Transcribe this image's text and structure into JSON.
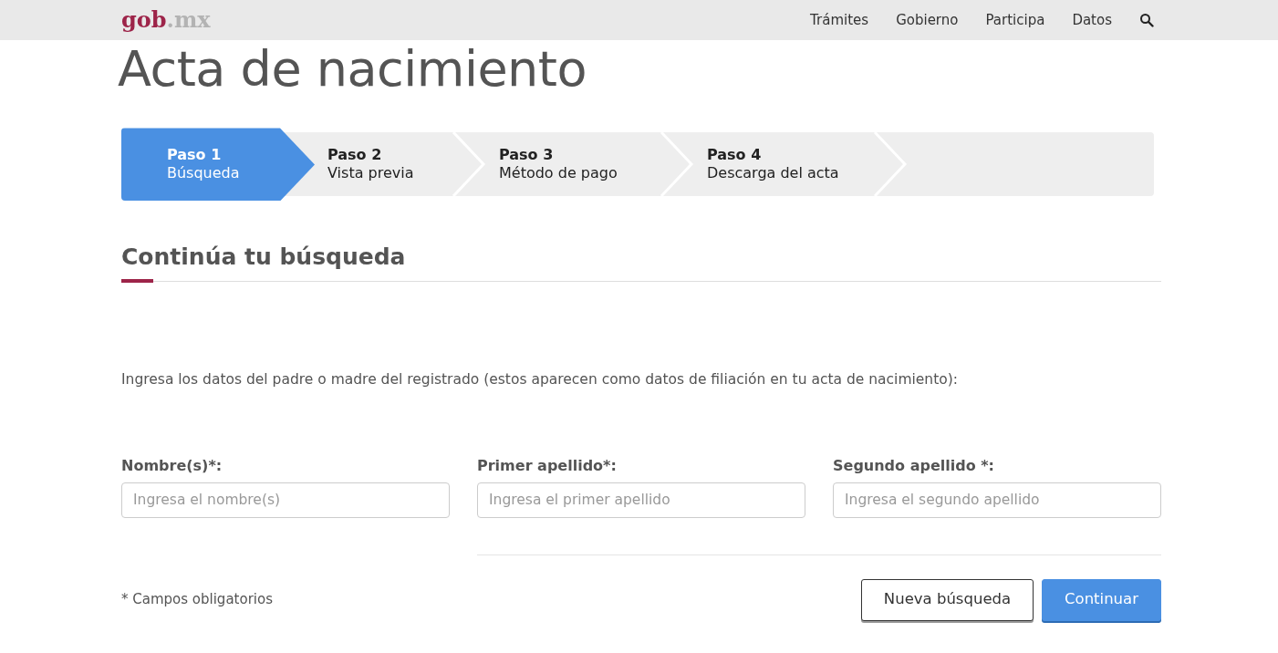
{
  "navbar": {
    "logo": {
      "main": "gob",
      "suffix": ".mx"
    },
    "links": [
      "Trámites",
      "Gobierno",
      "Participa",
      "Datos"
    ]
  },
  "title": "Acta de nacimiento",
  "steps": [
    {
      "label": "Paso 1",
      "name": "Búsqueda",
      "selected": true
    },
    {
      "label": "Paso 2",
      "name": "Vista previa",
      "selected": false
    },
    {
      "label": "Paso 3",
      "name": "Método de pago",
      "selected": false
    },
    {
      "label": "Paso 4",
      "name": "Descarga del acta",
      "selected": false
    }
  ],
  "section_title": "Continúa tu búsqueda",
  "instructions": "Ingresa los datos del padre o madre del registrado (estos aparecen como datos de filiación en tu acta de nacimiento):",
  "fields": [
    {
      "label": "Nombre(s)*:",
      "placeholder": "Ingresa el nombre(s)"
    },
    {
      "label": "Primer apellido*:",
      "placeholder": "Ingresa el primer apellido"
    },
    {
      "label": "Segundo apellido *:",
      "placeholder": "Ingresa el segundo apellido"
    }
  ],
  "required_note": "* Campos obligatorios",
  "buttons": [
    {
      "label": "Nueva búsqueda",
      "kind": "secondary"
    },
    {
      "label": "Continuar",
      "kind": "primary"
    }
  ]
}
